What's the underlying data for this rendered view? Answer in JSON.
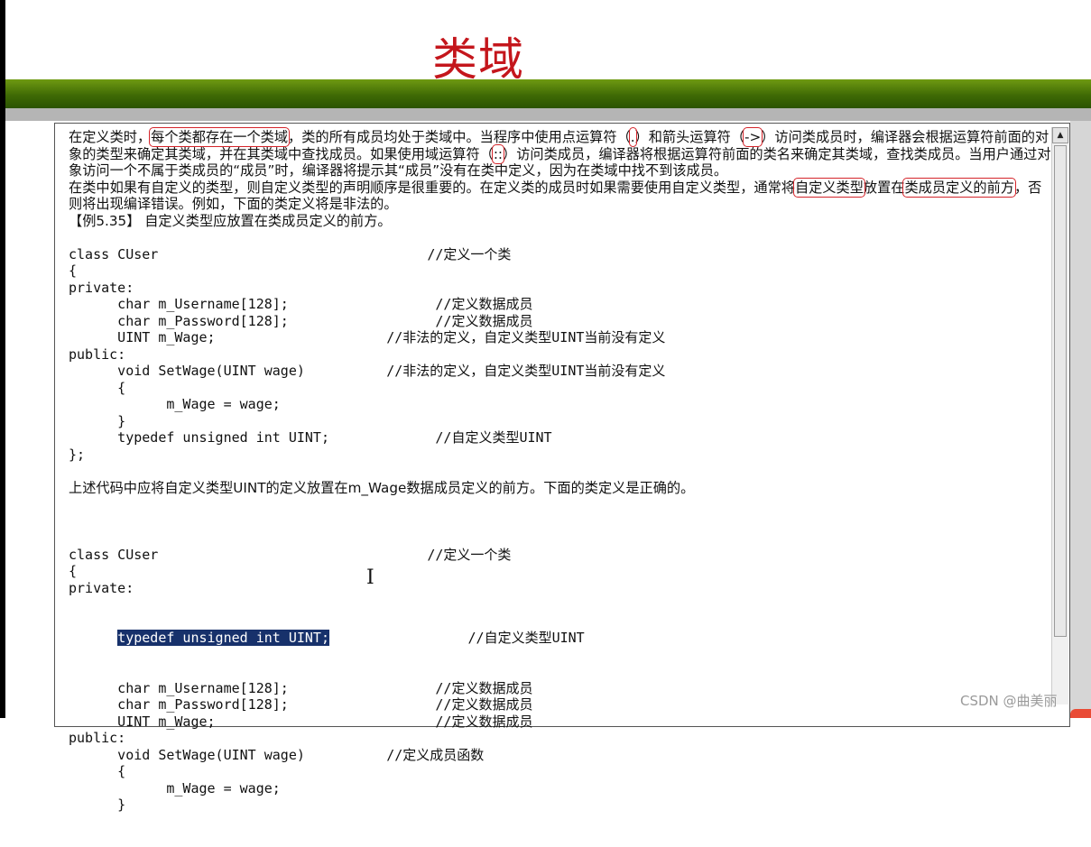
{
  "slide": {
    "title": "类域"
  },
  "document": {
    "para1": [
      {
        "t": "在定义类时，",
        "h": false
      },
      {
        "t": "每个类都存在一个类域",
        "h": true
      },
      {
        "t": "，类的所有成员均处于类域中。当程序中使用点运算符（",
        "h": false
      },
      {
        "t": ".",
        "h": true
      },
      {
        "t": "）和箭头运算符（",
        "h": false
      },
      {
        "t": "->",
        "h": true
      },
      {
        "t": "）访问类成员时，编译器会根据运算符前面的对象的类型来确定其类域，并在其类域中查找成员。如果使用域运算符（",
        "h": false
      },
      {
        "t": "::",
        "h": true
      },
      {
        "t": "）访问类成员，编译器将根据运算符前面的类名来确定其类域，查找类成员。当用户通过对象访问一个不属于类成员的“成员”时，编译器将提示其“成员”没有在类中定义，因为在类域中找不到该成员。",
        "h": false
      }
    ],
    "para2": [
      {
        "t": "在类中如果有自定义的类型，则自定义类型的声明顺序是很重要的。在定义类的成员时如果需要使用自定义类型，通常将",
        "h": false
      },
      {
        "t": "自定义类型",
        "h": true
      },
      {
        "t": "放置在",
        "h": false
      },
      {
        "t": "类成员定义的前方",
        "h": true
      },
      {
        "t": "，否则将出现编译错误。例如，下面的类定义将是非法的。",
        "h": false
      }
    ],
    "example_label": "【例5.35】 自定义类型应放置在类成员定义的前方。",
    "code1": [
      "class CUser                                 //定义一个类",
      "{",
      "private:",
      "      char m_Username[128];                  //定义数据成员",
      "      char m_Password[128];                  //定义数据成员",
      "      UINT m_Wage;                     //非法的定义，自定义类型UINT当前没有定义",
      "public:",
      "      void SetWage(UINT wage)          //非法的定义，自定义类型UINT当前没有定义",
      "      {",
      "            m_Wage = wage;",
      "      }",
      "      typedef unsigned int UINT;             //自定义类型UINT",
      "};"
    ],
    "middle_text": "上述代码中应将自定义类型UINT的定义放置在m_Wage数据成员定义的前方。下面的类定义是正确的。",
    "code2_before": [
      "class CUser                                 //定义一个类",
      "{",
      "private:"
    ],
    "code2_selected_indent": "      ",
    "code2_selected": "typedef unsigned int UINT;",
    "code2_selected_after": "                 //自定义类型UINT",
    "code2_after": [
      "      char m_Username[128];                  //定义数据成员",
      "      char m_Password[128];                  //定义数据成员",
      "      UINT m_Wage;                           //定义数据成员",
      "public:",
      "      void SetWage(UINT wage)          //定义成员函数",
      "      {",
      "            m_Wage = wage;",
      "      }"
    ]
  },
  "scrollbar": {
    "up_arrow_icon": "triangle-up-icon"
  },
  "cursor": {
    "glyph": "I"
  },
  "watermark": "CSDN @曲美丽",
  "colors": {
    "title": "#c4161c",
    "band": "#3f6a05",
    "highlight_box": "#d4242a",
    "selection": "#17316b"
  }
}
